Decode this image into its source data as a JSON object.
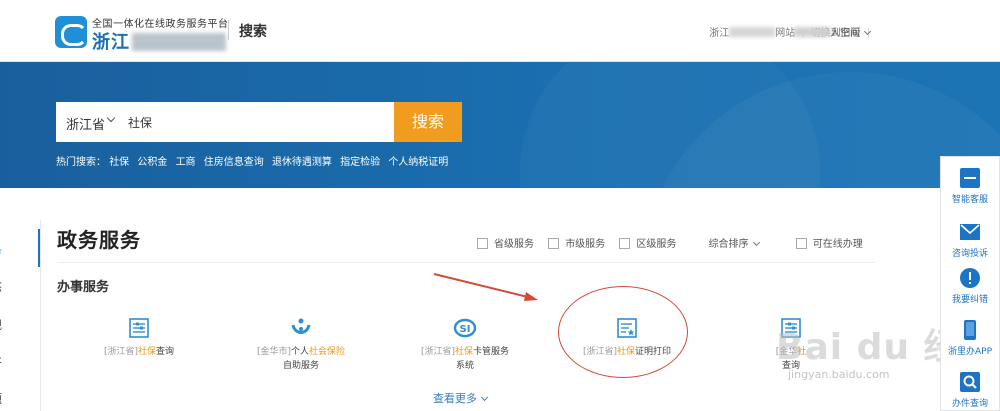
{
  "header": {
    "logo_subtitle": "全国一体化在线政务服务平台",
    "logo_title_visible": "浙江",
    "page_label": "搜索",
    "links": [
      "浙江",
      "网站",
      "切换到旧版"
    ],
    "user_space_visible": "人空间"
  },
  "search": {
    "region": "浙江省",
    "query": "社保",
    "button_label": "搜索",
    "hot_label": "热门搜索：",
    "hot_terms": [
      "社保",
      "公积金",
      "工商",
      "住房信息查询",
      "退休待遇测算",
      "指定检验",
      "个人纳税证明"
    ]
  },
  "left_nav": [
    "服务",
    "动态",
    "法规",
    "公开",
    "专题"
  ],
  "main": {
    "section_title": "政务服务",
    "filters": [
      "省级服务",
      "市级服务",
      "区级服务"
    ],
    "sort_label": "综合排序",
    "online_label": "可在线办理",
    "subsection_title": "办事服务",
    "services": [
      {
        "region": "[浙江省]",
        "keyword": "社保",
        "rest": "查询",
        "line2": ""
      },
      {
        "region": "[金华市]",
        "pre": "个人",
        "keyword": "社会保险",
        "line2": "自助服务"
      },
      {
        "region": "[浙江省]",
        "keyword": "社保",
        "rest": "卡管服务",
        "line2": "系统"
      },
      {
        "region": "[浙江省]",
        "keyword": "社保",
        "rest": "证明打印",
        "line2": ""
      },
      {
        "region": "[金华",
        "keyword": "社",
        "rest": "",
        "line2": "查询"
      }
    ],
    "more_label": "查看更多"
  },
  "right_bar": [
    "智能客服",
    "咨询投诉",
    "我要纠错",
    "浙里办APP",
    "办件查询"
  ],
  "watermark": {
    "text": "Bai du 经验",
    "url": "jingyan.baidu.com"
  },
  "colors": {
    "brand_blue": "#1d74c4",
    "banner": "#1a6fb0",
    "search_button": "#f09c1e",
    "highlight": "#e69a1c",
    "annotation_red": "#d34a3a"
  }
}
